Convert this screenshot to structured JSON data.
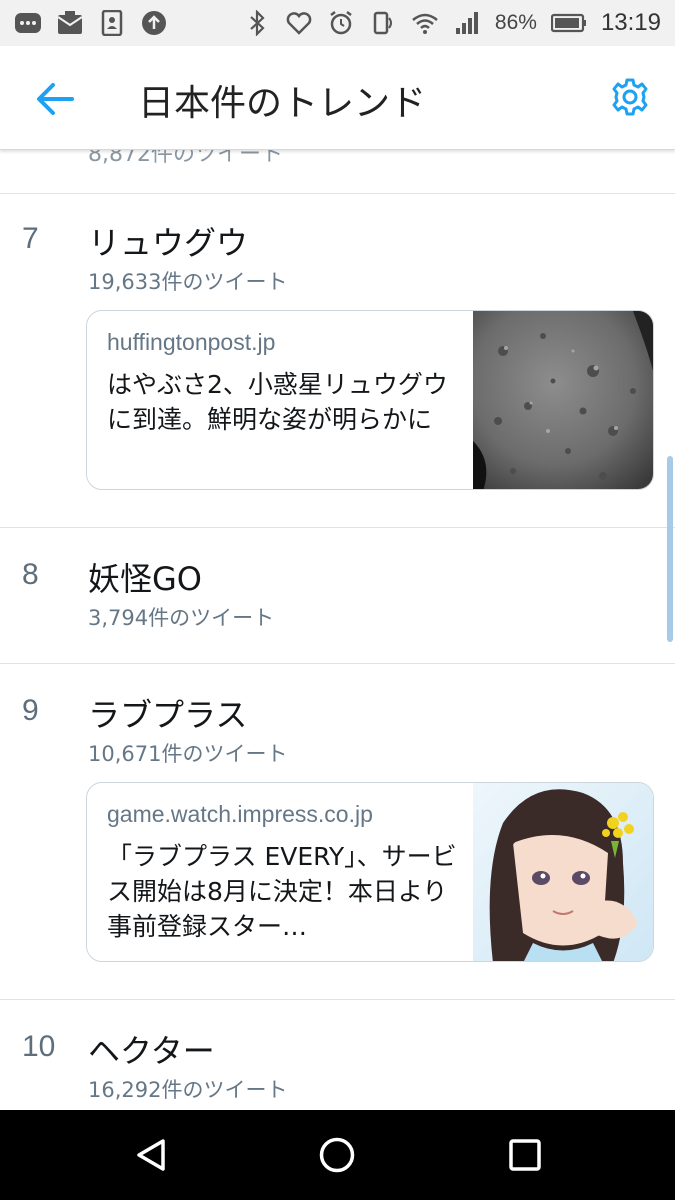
{
  "status_bar": {
    "battery": "86%",
    "time": "13:19"
  },
  "app_bar": {
    "title": "日本件のトレンド",
    "accent_color": "#1da1f2"
  },
  "partial_row": {
    "count": "8,872件のツイート"
  },
  "trends": [
    {
      "rank": "7",
      "topic": "リュウグウ",
      "count": "19,633件のツイート",
      "card": {
        "domain": "huffingtonpost.jp",
        "title": "はやぶさ2、小惑星リュウグウに到達。鮮明な姿が明らかに",
        "image": "asteroid-photo"
      }
    },
    {
      "rank": "8",
      "topic": "妖怪GO",
      "count": "3,794件のツイート"
    },
    {
      "rank": "9",
      "topic": "ラブプラス",
      "count": "10,671件のツイート",
      "card": {
        "domain": "game.watch.impress.co.jp",
        "title": "「ラブプラス EVERY」、サービス開始は8月に決定！本日より事前登録スター…",
        "image": "anime-girl-illustration"
      }
    },
    {
      "rank": "10",
      "topic": "ヘクター",
      "count": "16,292件のツイート"
    }
  ],
  "icons": {
    "back": "back-arrow-icon",
    "settings": "gear-icon",
    "nav_back": "triangle-back-icon",
    "nav_home": "circle-home-icon",
    "nav_recents": "square-recents-icon"
  }
}
